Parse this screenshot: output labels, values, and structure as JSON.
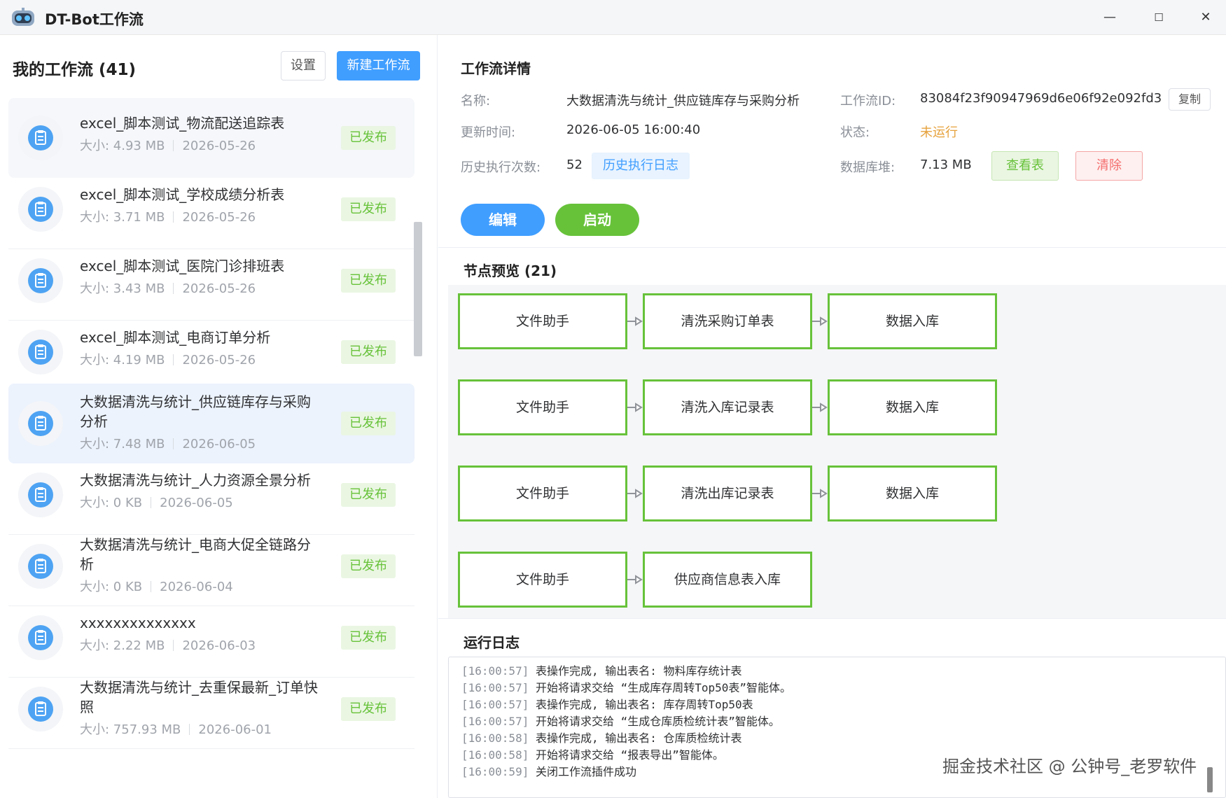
{
  "app": {
    "title": "DT-Bot工作流"
  },
  "window": {
    "minimize": "—",
    "maximize": "☐",
    "close": "✕"
  },
  "left": {
    "title": "我的工作流 (41)",
    "settings_label": "设置",
    "new_label": "新建工作流",
    "size_prefix": "大小: ",
    "items": [
      {
        "name": "excel_脚本测试_物流配送追踪表",
        "size": "4.93 MB",
        "date": "2026-05-26",
        "status": "已发布"
      },
      {
        "name": "excel_脚本测试_学校成绩分析表",
        "size": "3.71 MB",
        "date": "2026-05-26",
        "status": "已发布"
      },
      {
        "name": "excel_脚本测试_医院门诊排班表",
        "size": "3.43 MB",
        "date": "2026-05-26",
        "status": "已发布"
      },
      {
        "name": "excel_脚本测试_电商订单分析",
        "size": "4.19 MB",
        "date": "2026-05-26",
        "status": "已发布"
      },
      {
        "name": "大数据清洗与统计_供应链库存与采购分析",
        "size": "7.48 MB",
        "date": "2026-06-05",
        "status": "已发布"
      },
      {
        "name": "大数据清洗与统计_人力资源全景分析",
        "size": "0 KB",
        "date": "2026-06-05",
        "status": "已发布"
      },
      {
        "name": "大数据清洗与统计_电商大促全链路分析",
        "size": "0 KB",
        "date": "2026-06-04",
        "status": "已发布"
      },
      {
        "name": "xxxxxxxxxxxxxx",
        "size": "2.22 MB",
        "date": "2026-06-03",
        "status": "已发布"
      },
      {
        "name": "大数据清洗与统计_去重保最新_订单快照",
        "size": "757.93 MB",
        "date": "2026-06-01",
        "status": "已发布"
      }
    ]
  },
  "detail": {
    "title": "工作流详情",
    "name_label": "名称:",
    "name_value": "大数据清洗与统计_供应链库存与采购分析",
    "id_label": "工作流ID:",
    "id_value": "83084f23f90947969d6e06f92e092fd3",
    "copy_label": "复制",
    "updated_label": "更新时间:",
    "updated_value": "2026-06-05 16:00:40",
    "status_label": "状态:",
    "status_value": "未运行",
    "count_label": "历史执行次数:",
    "count_value": "52",
    "history_label": "历史执行日志",
    "db_label": "数据库堆:",
    "db_value": "7.13 MB",
    "view_label": "查看表",
    "clear_label": "清除",
    "edit_label": "编辑",
    "start_label": "启动"
  },
  "nodes": {
    "title": "节点预览 (21)",
    "rows": [
      [
        "文件助手",
        "清洗采购订单表",
        "数据入库"
      ],
      [
        "文件助手",
        "清洗入库记录表",
        "数据入库"
      ],
      [
        "文件助手",
        "清洗出库记录表",
        "数据入库"
      ],
      [
        "文件助手",
        "供应商信息表入库"
      ]
    ]
  },
  "log": {
    "title": "运行日志",
    "lines": [
      {
        "ts": "[16:00:57]",
        "msg": "表操作完成, 输出表名:  物料库存统计表"
      },
      {
        "ts": "[16:00:57]",
        "msg": "开始将请求交给 “生成库存周转Top50表”智能体。"
      },
      {
        "ts": "[16:00:57]",
        "msg": "表操作完成, 输出表名:  库存周转Top50表"
      },
      {
        "ts": "[16:00:57]",
        "msg": "开始将请求交给 “生成仓库质检统计表”智能体。"
      },
      {
        "ts": "[16:00:58]",
        "msg": "表操作完成, 输出表名:  仓库质检统计表"
      },
      {
        "ts": "[16:00:58]",
        "msg": "开始将请求交给 “报表导出”智能体。"
      },
      {
        "ts": "[16:00:59]",
        "msg": "关闭工作流插件成功"
      }
    ]
  },
  "watermark": "掘金技术社区 @ 公钟号_老罗软件",
  "colors": {
    "primary": "#409eff",
    "success": "#67c23a",
    "warning": "#e6a23c",
    "danger": "#f56c6c"
  }
}
